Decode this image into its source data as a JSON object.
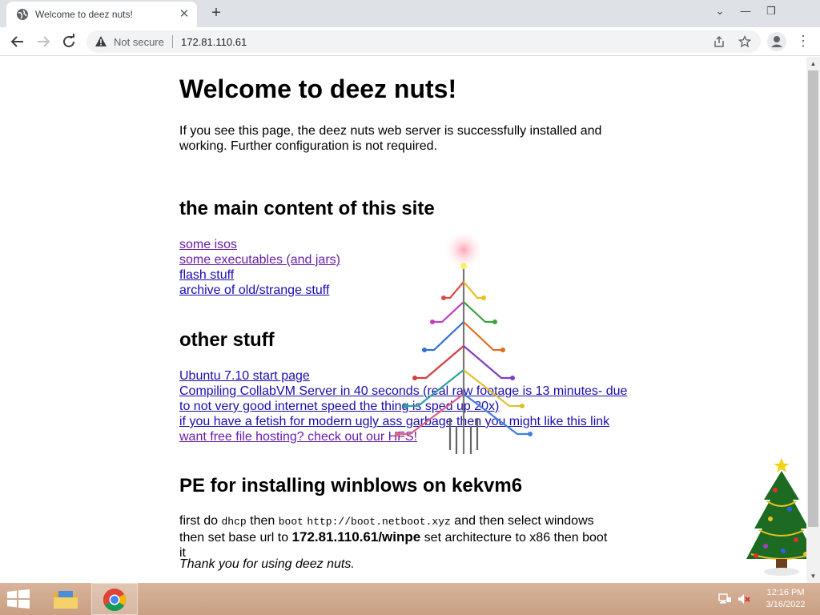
{
  "browser": {
    "tab_title": "Welcome to deez nuts!",
    "security_label": "Not secure",
    "url": "172.81.110.61"
  },
  "page": {
    "heading": "Welcome to deez nuts!",
    "intro": "If you see this page, the deez nuts web server is successfully installed and working. Further configuration is not required.",
    "section_main": {
      "heading": "the main content of this site",
      "links": [
        "some isos",
        "some executables (and jars)",
        "flash stuff",
        "archive of old/strange stuff"
      ]
    },
    "section_other": {
      "heading": "other stuff",
      "links": [
        "Ubuntu 7.10 start page",
        "Compiling CollabVM Server in 40 seconds (real raw footage is 13 minutes- due to not very good internet speed the thing is sped up 20x)",
        "if you have a fetish for modern ugly ass garbage then you might like this link",
        "want free file hosting? check out our HFS!"
      ]
    },
    "section_pe": {
      "heading": "PE for installing winblows on kekvm6",
      "text_1": "first do",
      "code_1": "dhcp",
      "text_2": "then",
      "code_2": "boot",
      "code_3": "http://boot.netboot.xyz",
      "text_3": "and then select windows then set base url to",
      "bold_url": "172.81.110.61/winpe",
      "text_4": "set architecture to x86 then boot it"
    },
    "footer": "Thank you for using deez nuts."
  },
  "taskbar": {
    "time": "12:16 PM",
    "date": "3/16/2022",
    "apps": [
      "file-explorer",
      "chrome"
    ]
  },
  "icons": [
    "globe-icon",
    "close-icon",
    "plus-icon",
    "chevron-down-icon",
    "minimize-icon",
    "restore-icon",
    "back-arrow-icon",
    "forward-arrow-icon",
    "reload-icon",
    "warning-icon",
    "share-icon",
    "star-icon",
    "profile-icon",
    "kebab-menu-icon",
    "windows-logo-icon",
    "network-icon",
    "muted-speaker-icon"
  ],
  "colors": {
    "link": "#1a0dab",
    "visited_link": "#681da8",
    "tabstrip": "#dee1e6",
    "taskbar": "#c99f83"
  }
}
